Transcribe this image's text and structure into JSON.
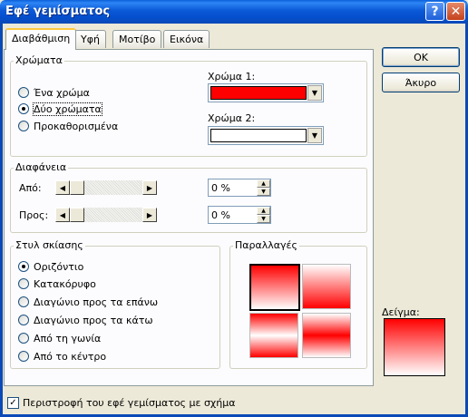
{
  "window": {
    "title": "Εφέ γεμίσματος",
    "help_label": "?",
    "close_label": "✕"
  },
  "tabs": [
    {
      "label": "Διαβάθμιση",
      "active": true
    },
    {
      "label": "Υφή",
      "active": false
    },
    {
      "label": "Μοτίβο",
      "active": false
    },
    {
      "label": "Εικόνα",
      "active": false
    }
  ],
  "colors_group": {
    "title": "Χρώματα",
    "options": [
      {
        "label": "Ένα χρώμα",
        "checked": false
      },
      {
        "label": "Δύο χρώματα",
        "checked": true
      },
      {
        "label": "Προκαθορισμένα",
        "checked": false
      }
    ],
    "color1_label": "Χρώμα 1:",
    "color1_value": "#ff0000",
    "color2_label": "Χρώμα 2:",
    "color2_value": "#ffffff",
    "dropdown_glyph": "▼"
  },
  "transparency_group": {
    "title": "Διαφάνεια",
    "from_label": "Από:",
    "from_value": "0 %",
    "to_label": "Προς:",
    "to_value": "0 %",
    "left_glyph": "◀",
    "right_glyph": "▶",
    "up_glyph": "▲",
    "down_glyph": "▼"
  },
  "shading_group": {
    "title": "Στυλ σκίασης",
    "options": [
      {
        "label": "Οριζόντιο",
        "checked": true
      },
      {
        "label": "Κατακόρυφο",
        "checked": false
      },
      {
        "label": "Διαγώνιο προς τα επάνω",
        "checked": false
      },
      {
        "label": "Διαγώνιο προς τα κάτω",
        "checked": false
      },
      {
        "label": "Από τη γωνία",
        "checked": false
      },
      {
        "label": "Από το κέντρο",
        "checked": false
      }
    ]
  },
  "variants_group": {
    "title": "Παραλλαγές"
  },
  "buttons": {
    "ok": "OK",
    "cancel": "Άκυρο"
  },
  "sample": {
    "label": "Δείγμα:"
  },
  "rotate_checkbox": {
    "label": "Περιστροφή του εφέ γεμίσματος με σχήμα",
    "checked": true,
    "glyph": "✓"
  },
  "accent_colors": {
    "title_bar": "#0a5fd8",
    "gradient_color": "#ff0000"
  }
}
